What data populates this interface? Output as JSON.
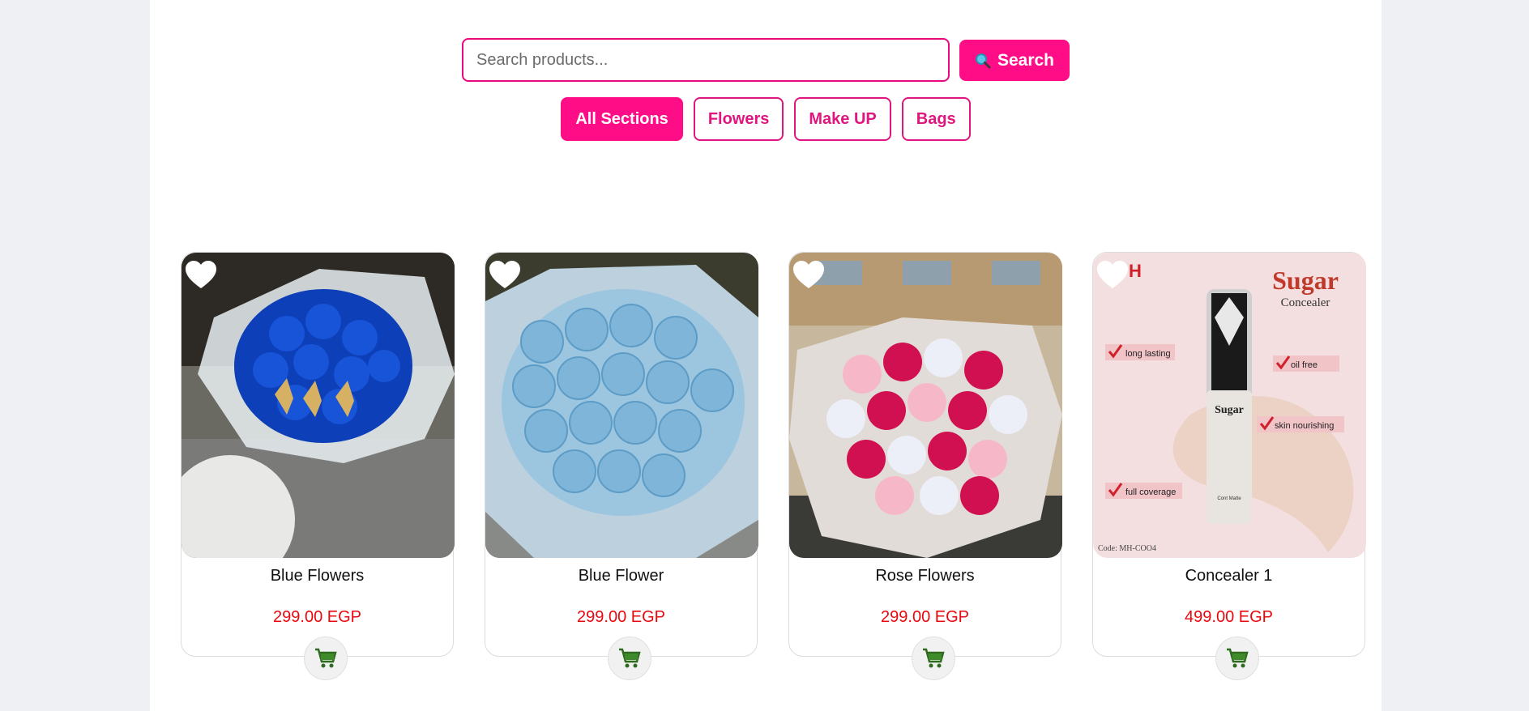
{
  "search": {
    "placeholder": "Search products...",
    "value": "",
    "button_label": "Search",
    "button_icon": "magnifier-icon"
  },
  "filters": [
    {
      "label": "All Sections",
      "active": true
    },
    {
      "label": "Flowers",
      "active": false
    },
    {
      "label": "Make UP",
      "active": false
    },
    {
      "label": "Bags",
      "active": false
    }
  ],
  "products": [
    {
      "name": "Blue Flowers",
      "price": "299.00 EGP",
      "image": "royal-blue-rose-bouquet"
    },
    {
      "name": "Blue Flower",
      "price": "299.00 EGP",
      "image": "light-blue-rose-bouquet"
    },
    {
      "name": "Rose Flowers",
      "price": "299.00 EGP",
      "image": "pink-white-rose-bouquet"
    },
    {
      "name": "Concealer 1",
      "price": "499.00 EGP",
      "image": "sugar-concealer-ad"
    }
  ],
  "concealer_ad": {
    "brand": "Sugar",
    "sub": "Concealer",
    "tube_label": "Sugar",
    "features": [
      "long lasting",
      "oil free",
      "skin nourishing",
      "full coverage"
    ],
    "code": "Code: MH-COO4",
    "logo": "H",
    "tube_small": "Cont Matte"
  },
  "colors": {
    "accent": "#ff0c87",
    "price": "#e8080f",
    "cart": "#2e6b1f"
  }
}
